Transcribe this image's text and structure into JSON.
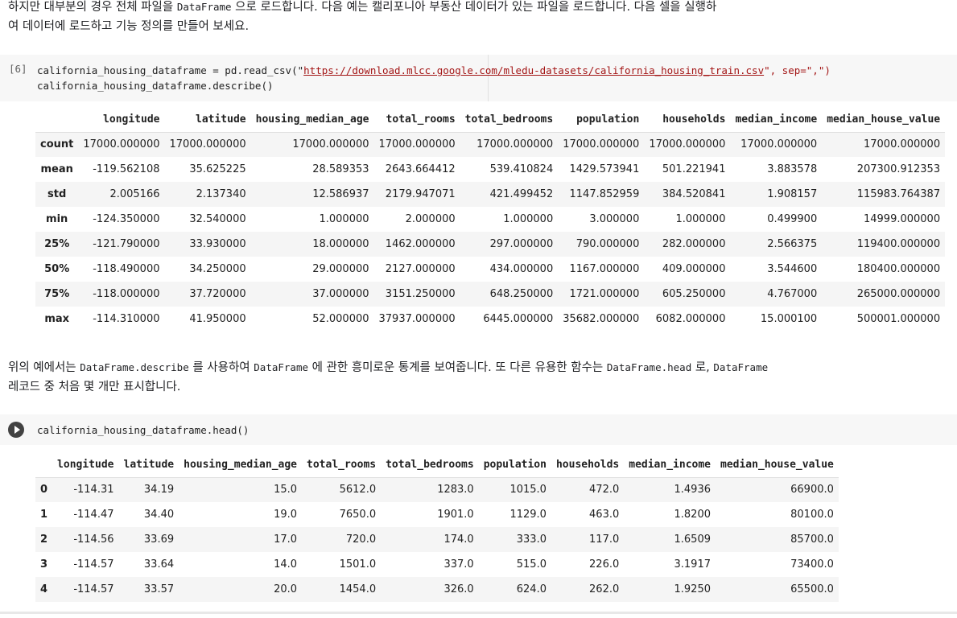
{
  "md1": {
    "line1_a": "하지만 대부분의 경우 전체 파일을 ",
    "line1_code": "DataFrame",
    "line1_b": " 으로 로드합니다. 다음 예는 캘리포니아 부동산 데이터가 있는 파일을 로드합니다. 다음 셀을 실행하",
    "line2": "여 데이터에 로드하고 기능 정의를 만들어 보세요."
  },
  "cell1": {
    "exec_count": "[6]",
    "line1_a": "california_housing_dataframe = pd.read_csv(\"",
    "line1_url": "https://download.mlcc.google.com/mledu-datasets/california_housing_train.csv",
    "line1_b": "\", sep=\",\")",
    "line2": "california_housing_dataframe.describe()"
  },
  "describe": {
    "columns": [
      "",
      "longitude",
      "latitude",
      "housing_median_age",
      "total_rooms",
      "total_bedrooms",
      "population",
      "households",
      "median_income",
      "median_house_value"
    ],
    "rows": [
      [
        "count",
        "17000.000000",
        "17000.000000",
        "17000.000000",
        "17000.000000",
        "17000.000000",
        "17000.000000",
        "17000.000000",
        "17000.000000",
        "17000.000000"
      ],
      [
        "mean",
        "-119.562108",
        "35.625225",
        "28.589353",
        "2643.664412",
        "539.410824",
        "1429.573941",
        "501.221941",
        "3.883578",
        "207300.912353"
      ],
      [
        "std",
        "2.005166",
        "2.137340",
        "12.586937",
        "2179.947071",
        "421.499452",
        "1147.852959",
        "384.520841",
        "1.908157",
        "115983.764387"
      ],
      [
        "min",
        "-124.350000",
        "32.540000",
        "1.000000",
        "2.000000",
        "1.000000",
        "3.000000",
        "1.000000",
        "0.499900",
        "14999.000000"
      ],
      [
        "25%",
        "-121.790000",
        "33.930000",
        "18.000000",
        "1462.000000",
        "297.000000",
        "790.000000",
        "282.000000",
        "2.566375",
        "119400.000000"
      ],
      [
        "50%",
        "-118.490000",
        "34.250000",
        "29.000000",
        "2127.000000",
        "434.000000",
        "1167.000000",
        "409.000000",
        "3.544600",
        "180400.000000"
      ],
      [
        "75%",
        "-118.000000",
        "37.720000",
        "37.000000",
        "3151.250000",
        "648.250000",
        "1721.000000",
        "605.250000",
        "4.767000",
        "265000.000000"
      ],
      [
        "max",
        "-114.310000",
        "41.950000",
        "52.000000",
        "37937.000000",
        "6445.000000",
        "35682.000000",
        "6082.000000",
        "15.000100",
        "500001.000000"
      ]
    ]
  },
  "md2": {
    "l1_a": "위의 예에서는 ",
    "l1_code1": "DataFrame.describe",
    "l1_b": " 를 사용하여 ",
    "l1_code2": "DataFrame",
    "l1_c": " 에 관한 흥미로운 통계를 보여줍니다. 또 다른 유용한 함수는 ",
    "l1_code3": "DataFrame.head",
    "l1_d": " 로, ",
    "l1_code4": "DataFrame",
    "line2": "레코드 중 처음 몇 개만 표시합니다."
  },
  "cell2": {
    "code": "california_housing_dataframe.head()",
    "run_icon": "play-icon"
  },
  "head": {
    "columns": [
      "",
      "longitude",
      "latitude",
      "housing_median_age",
      "total_rooms",
      "total_bedrooms",
      "population",
      "households",
      "median_income",
      "median_house_value"
    ],
    "rows": [
      [
        "0",
        "-114.31",
        "34.19",
        "15.0",
        "5612.0",
        "1283.0",
        "1015.0",
        "472.0",
        "1.4936",
        "66900.0"
      ],
      [
        "1",
        "-114.47",
        "34.40",
        "19.0",
        "7650.0",
        "1901.0",
        "1129.0",
        "463.0",
        "1.8200",
        "80100.0"
      ],
      [
        "2",
        "-114.56",
        "33.69",
        "17.0",
        "720.0",
        "174.0",
        "333.0",
        "117.0",
        "1.6509",
        "85700.0"
      ],
      [
        "3",
        "-114.57",
        "33.64",
        "14.0",
        "1501.0",
        "337.0",
        "515.0",
        "226.0",
        "3.1917",
        "73400.0"
      ],
      [
        "4",
        "-114.57",
        "33.57",
        "20.0",
        "1454.0",
        "326.0",
        "624.0",
        "262.0",
        "1.9250",
        "65500.0"
      ]
    ]
  }
}
